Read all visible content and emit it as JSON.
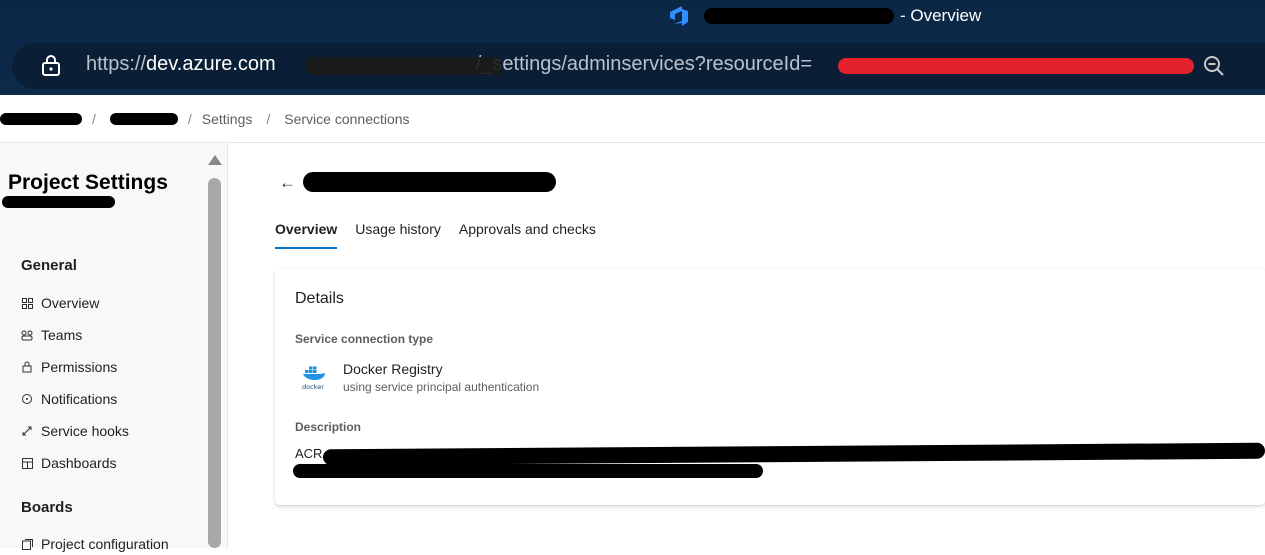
{
  "window": {
    "title_suffix": "- Overview"
  },
  "address_bar": {
    "scheme": "https://",
    "host": "dev.azure.com",
    "path_middle": "/_settings/adminservices?resourceId="
  },
  "breadcrumb": {
    "settings": "Settings",
    "service_connections": "Service connections",
    "separator": "/"
  },
  "sidebar": {
    "title": "Project Settings",
    "sections": [
      {
        "heading": "General",
        "items": [
          {
            "label": "Overview",
            "icon": "grid-icon"
          },
          {
            "label": "Teams",
            "icon": "people-icon"
          },
          {
            "label": "Permissions",
            "icon": "lock-icon"
          },
          {
            "label": "Notifications",
            "icon": "chat-icon"
          },
          {
            "label": "Service hooks",
            "icon": "hook-icon"
          },
          {
            "label": "Dashboards",
            "icon": "dashboard-icon"
          }
        ]
      },
      {
        "heading": "Boards",
        "items": [
          {
            "label": "Project configuration",
            "icon": "config-icon"
          }
        ]
      }
    ]
  },
  "main": {
    "tabs": [
      {
        "label": "Overview",
        "active": true
      },
      {
        "label": "Usage history",
        "active": false
      },
      {
        "label": "Approvals and checks",
        "active": false
      }
    ],
    "details": {
      "heading": "Details",
      "type_label": "Service connection type",
      "type_name": "Docker Registry",
      "type_sub": "using service principal authentication",
      "description_label": "Description",
      "description_prefix": "ACR"
    }
  },
  "colors": {
    "accent": "#0078d4",
    "chrome_bg": "#0b2746",
    "redaction_red": "#e3222e"
  }
}
